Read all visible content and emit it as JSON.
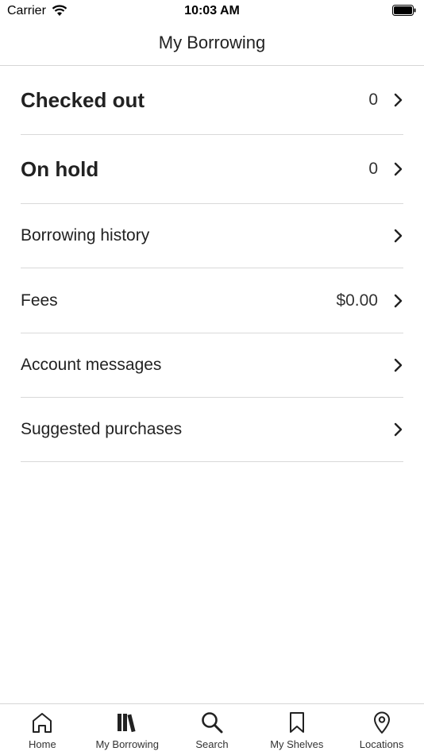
{
  "status_bar": {
    "carrier": "Carrier",
    "time": "10:03 AM",
    "wifi_icon": "wifi-icon",
    "battery_icon": "battery-icon"
  },
  "nav": {
    "title": "My Borrowing"
  },
  "rows": [
    {
      "label": "Checked out",
      "value": "0"
    },
    {
      "label": "On hold",
      "value": "0"
    },
    {
      "label": "Borrowing history",
      "value": ""
    },
    {
      "label": "Fees",
      "value": "$0.00"
    },
    {
      "label": "Account messages",
      "value": ""
    },
    {
      "label": "Suggested purchases",
      "value": ""
    }
  ],
  "tabs": [
    {
      "label": "Home",
      "icon": "home-icon"
    },
    {
      "label": "My Borrowing",
      "icon": "books-icon"
    },
    {
      "label": "Search",
      "icon": "search-icon"
    },
    {
      "label": "My Shelves",
      "icon": "bookmark-icon"
    },
    {
      "label": "Locations",
      "icon": "location-pin-icon"
    }
  ],
  "colors": {
    "text": "#222222",
    "divider": "#d9d9d9",
    "background": "#ffffff"
  }
}
